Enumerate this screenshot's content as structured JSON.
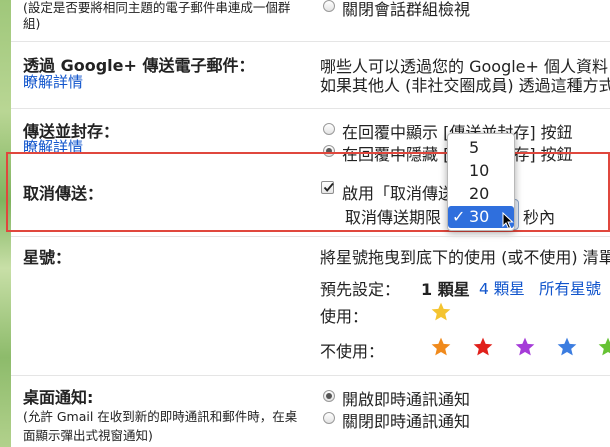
{
  "left_column": {
    "top_note": "(設定是否要將相同主題的電子郵件串連成一個群組)",
    "top_note_line1": "(設定是否要將相同主題的電子郵件串連成一個群",
    "top_note_line2": "組)",
    "gplus_label": "透過 Google+ 傳送電子郵件：",
    "gplus_link": "瞭解詳情",
    "send_archive_label": "傳送並封存：",
    "send_archive_link": "瞭解詳情",
    "undo_send_label": "取消傳送：",
    "stars_label": "星號：",
    "desktop_notif_label": "桌面通知:",
    "desktop_notif_note_line1": "(允許 Gmail 在收到新的即時通訊和郵件時，在桌",
    "desktop_notif_note_line2": "面顯示彈出式視窗通知)"
  },
  "conversation_view": {
    "off_label": "關閉會話群組檢視"
  },
  "gplus": {
    "desc_line1": "哪些人可以透過您的 Google+ 個人資料",
    "desc_line2": "如果其他人 (非社交圈成員) 透過這種方式"
  },
  "send_archive": {
    "show_label": "在回覆中顯示 [傳送並封存] 按鈕",
    "hide_label": "在回覆中隱藏 [傳送並封存] 按鈕"
  },
  "undo_send": {
    "enable_label": "啟用「取消傳送」",
    "period_label": "取消傳送期限",
    "unit_label": "秒內",
    "selected_value": "30",
    "options": [
      "5",
      "10",
      "20",
      "30"
    ]
  },
  "stars": {
    "desc": "將星號拖曳到底下的使用 (或不使用) 清單",
    "presets_label": "預先設定：",
    "preset_1": "1 顆星",
    "preset_4": "4 顆星",
    "preset_all": "所有星號",
    "in_use_label": "使用：",
    "not_in_use_label": "不使用：",
    "in_use_star_color": "#f4c430",
    "not_in_use_colors": [
      "#f08a1c",
      "#e0201b",
      "#a53bd8",
      "#3c7de0",
      "#66c234"
    ]
  },
  "desktop_notifications": {
    "on_label": "開啟即時通訊通知",
    "off_label": "關閉即時通訊通知"
  },
  "colors": {
    "link": "#1155cc",
    "highlight_border": "#e0473d",
    "dropdown_selected": "#2f6fdd"
  }
}
